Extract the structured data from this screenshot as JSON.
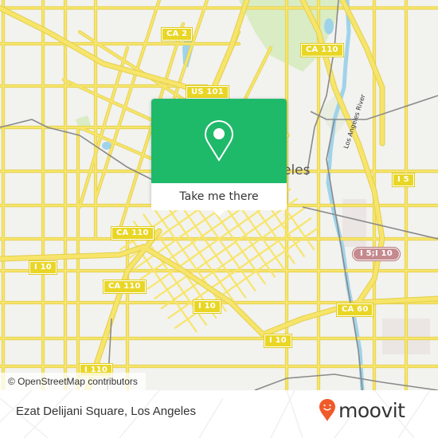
{
  "map": {
    "city_label_suffix": "eles",
    "river_label": "Los Angeles River",
    "shields": [
      {
        "id": "ca2",
        "text": "CA 2",
        "type": "state"
      },
      {
        "id": "us101",
        "text": "US 101",
        "type": "us"
      },
      {
        "id": "ca110-top",
        "text": "CA 110",
        "type": "state"
      },
      {
        "id": "i5",
        "text": "I 5",
        "type": "interstate"
      },
      {
        "id": "ca110-mid",
        "text": "CA 110",
        "type": "state"
      },
      {
        "id": "i10-left",
        "text": "I 10",
        "type": "interstate"
      },
      {
        "id": "i5-i10",
        "text": "I 5;I 10",
        "type": "interstate-combo"
      },
      {
        "id": "ca110-low",
        "text": "CA 110",
        "type": "state"
      },
      {
        "id": "i10-center",
        "text": "I 10",
        "type": "interstate"
      },
      {
        "id": "ca60",
        "text": "CA 60",
        "type": "state"
      },
      {
        "id": "i10-lower",
        "text": "I 10",
        "type": "interstate"
      },
      {
        "id": "i110",
        "text": "I 110",
        "type": "interstate"
      }
    ],
    "attribution": "© OpenStreetMap contributors",
    "colors": {
      "background": "#f2f2ef",
      "road": "#f7e56b",
      "road_outline": "#e3cf4c",
      "park": "#d9ecc4",
      "water": "#9fd3ea",
      "rail": "#8a8a8a",
      "shield": "#e9d625",
      "shield_combo": "#c58a8e"
    }
  },
  "popup": {
    "icon": "map-pin-icon",
    "cta_label": "Take me there",
    "accent_color": "#1fb96a"
  },
  "footer": {
    "place_name": "Ezat Delijani Square, Los Angeles",
    "brand_name": "moovit",
    "brand_color": "#f05a28"
  }
}
